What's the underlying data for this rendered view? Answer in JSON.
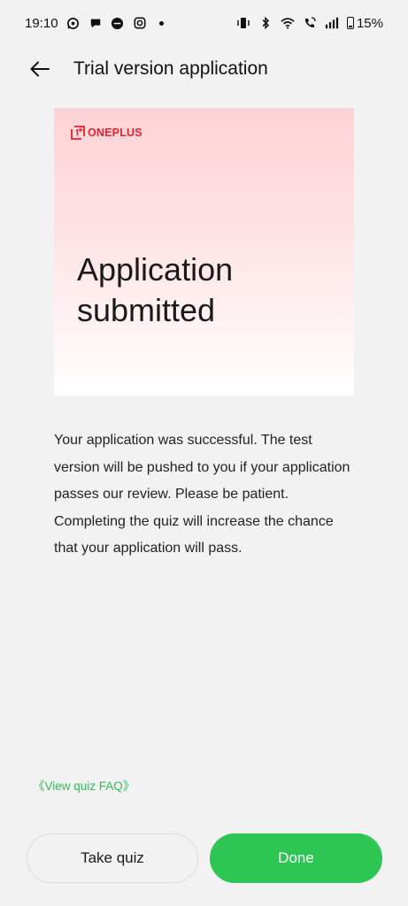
{
  "status_bar": {
    "time": "19:10",
    "battery_text": "15%",
    "notification_icons": [
      "whatsapp-icon",
      "chat-bubble-icon",
      "messenger-icon",
      "instagram-icon",
      "more-dot-icon"
    ],
    "system_icons": [
      "vibrate-icon",
      "bluetooth-icon",
      "wifi-icon",
      "wifi-calling-icon",
      "signal-icon",
      "battery-icon"
    ]
  },
  "header": {
    "title": "Trial version application"
  },
  "banner": {
    "brand": "ONEPLUS",
    "heading": "Application submitted",
    "brand_color": "#e0252f"
  },
  "body": {
    "description": "Your application was successful. The test version will be pushed to you if your application passes our review. Please be patient. Completing the quiz will increase the chance that your application will pass."
  },
  "links": {
    "faq": "《View quiz FAQ》"
  },
  "actions": {
    "take_quiz_label": "Take quiz",
    "done_label": "Done",
    "accent_color": "#2dc653"
  }
}
